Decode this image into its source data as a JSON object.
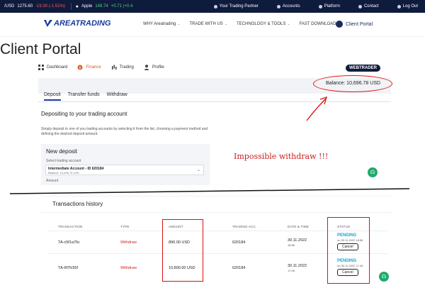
{
  "ticker": [
    {
      "symbol": "/USD",
      "price": "1275.60",
      "change": "-19.30 (-1.51%)",
      "dir": "neg"
    },
    {
      "symbol": "Apple",
      "price": "148.74",
      "change": "+0.71 (+0.4",
      "dir": "pos"
    }
  ],
  "topnav": [
    "Your Trading Partner",
    "Accounts",
    "Platform",
    "Contact",
    "Log Out"
  ],
  "logo": "AREATRADING",
  "menu": [
    "WHY Areatrading",
    "TRADE WITH US",
    "TECHNOLOGY & TOOLS",
    "FAST DOWNLOADS"
  ],
  "portal_link": "Client Portal",
  "page_title": "Client Portal",
  "tabs": [
    "Dashboard",
    "Finance",
    "Trading",
    "Profile"
  ],
  "webtrader": "WEBTRADER",
  "balance": "Balance: 10,696.78 USD",
  "subtabs": [
    "Deposit",
    "Transfer funds",
    "Withdraw"
  ],
  "deposit": {
    "heading": "Depositing to your trading account",
    "text": "Simply deposit to one of you trading accounts by selecting it from the list, choosing a payment method and defining the desired deposit amount.",
    "box_title": "New deposit",
    "select_label": "Select trading account",
    "selected_account": "Intermediate Account - ID 620184",
    "selected_balance": "Balance: 10,696.78 USD",
    "amount_label": "Amount"
  },
  "annotation": "Impossible withdraw !!!",
  "history": {
    "title": "Transactions history",
    "headers": [
      "TRANSACTION",
      "TYPE",
      "AMOUNT",
      "TRADING ACC.",
      "DATE & TIME",
      "STATUS"
    ],
    "rows": [
      {
        "id": "TA-c5f1a76c",
        "type": "Withdraw",
        "amount": "896.00 USD",
        "account": "620184",
        "date": "30.11.2022",
        "time": "18:56",
        "status": "PENDING",
        "status_detail": "on 30.11.2022 18:56",
        "action": "Cancel"
      },
      {
        "id": "TA-6f7fc55f",
        "type": "Withdraw",
        "amount": "10,800.00 USD",
        "account": "620184",
        "date": "30.11.2022",
        "time": "17:45",
        "status": "PENDING",
        "status_detail": "on 30.11.2022 17:45",
        "action": "Cancel"
      }
    ]
  },
  "colors": {
    "navy": "#0f1b3d",
    "brand_blue": "#1a3d9b",
    "accent_orange": "#e05a2a",
    "annotation_red": "#e01010",
    "pending_blue": "#1aa3d8",
    "chat_green": "#1faa6b"
  }
}
